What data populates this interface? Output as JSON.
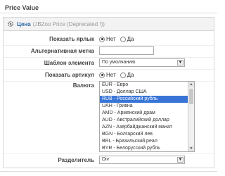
{
  "panel": {
    "title": "Price Value"
  },
  "header": {
    "name": "Цена",
    "note": "(JBZoo Price (Deprecated !))"
  },
  "fields": {
    "show_label": {
      "label": "Показать ярлык",
      "opt_no": "Нет",
      "opt_yes": "Да"
    },
    "alt_label": {
      "label": "Альтернативная метка",
      "value": ""
    },
    "template": {
      "label": "Шаблон элемента",
      "value": "По умолчанию"
    },
    "show_sku": {
      "label": "Показать артикул",
      "opt_no": "Нет",
      "opt_yes": "Да"
    },
    "currency": {
      "label": "Валюта",
      "options": [
        "EUR - Евро",
        "USD - Доллар США",
        "RUB - Российский рубль",
        "UAH - Гривна",
        "AMD - Армянский драм",
        "AUD - Австралийский доллар",
        "AZN - Азербайджанский манат",
        "BGN - Болгарский лев",
        "BRL - Бразильский реал",
        "BYR - Белорусский рубль"
      ],
      "selected_index": 2
    },
    "separator": {
      "label": "Разделитель",
      "value": "Div"
    }
  },
  "colors": {
    "accent": "#2b67a6",
    "selected": "#3875d7"
  }
}
